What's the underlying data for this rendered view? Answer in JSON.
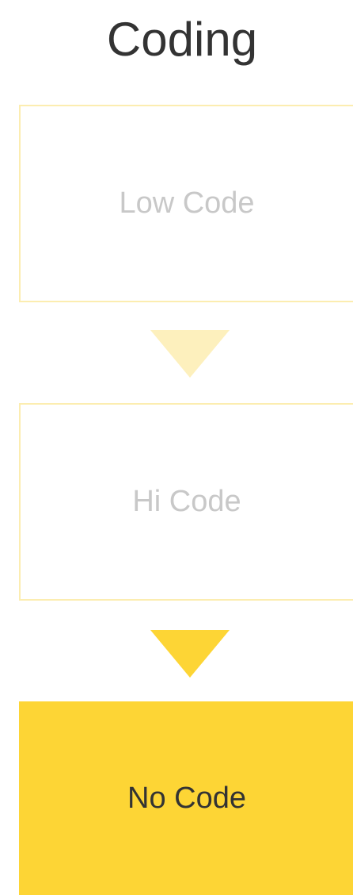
{
  "title": "Coding",
  "steps": [
    {
      "label": "Low Code",
      "state": "inactive"
    },
    {
      "label": "Hi Code",
      "state": "inactive"
    },
    {
      "label": "No Code",
      "state": "active"
    }
  ],
  "colors": {
    "accent": "#fdd535",
    "inactive_border": "#fcedb0",
    "inactive_arrow": "#fdf0bd",
    "inactive_text": "#c8c8c8",
    "active_text": "#333333",
    "title_text": "#333333"
  }
}
